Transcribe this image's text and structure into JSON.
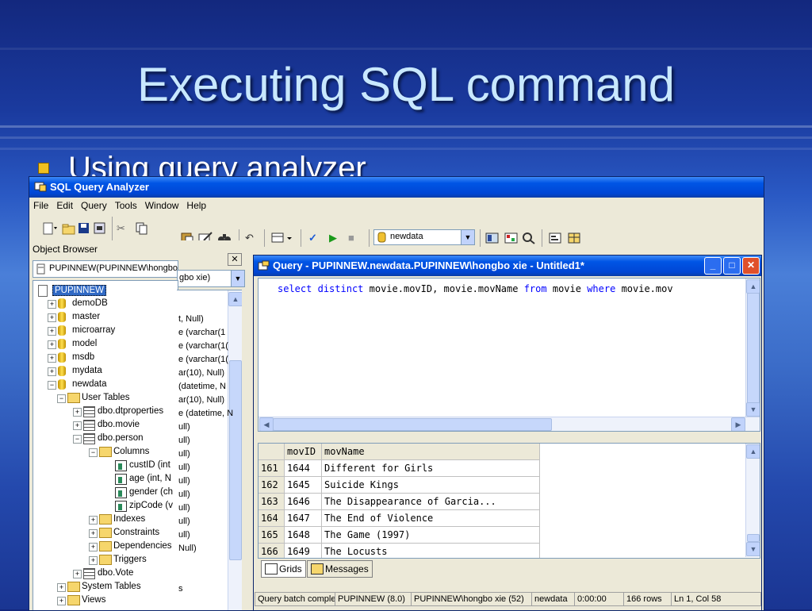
{
  "slide": {
    "title": "Executing SQL command",
    "bullet": "Using query analyzer"
  },
  "app": {
    "title": "SQL Query Analyzer",
    "menu": [
      "File",
      "Edit",
      "Query",
      "Tools",
      "Window",
      "Help"
    ],
    "toolbar": {
      "database": "newdata"
    }
  },
  "object_browser": {
    "label": "Object Browser",
    "server_select": "PUPINNEW(PUPINNEW\\hongbo xie)",
    "server_select_tail": "gbo xie)",
    "tree": [
      {
        "label": "PUPINNEW",
        "level": 0,
        "type": "server",
        "selected": true
      },
      {
        "label": "demoDB",
        "level": 1,
        "type": "db",
        "expander": "+"
      },
      {
        "label": "master",
        "level": 1,
        "type": "db",
        "expander": "+"
      },
      {
        "label": "microarray",
        "level": 1,
        "type": "db",
        "expander": "+"
      },
      {
        "label": "model",
        "level": 1,
        "type": "db",
        "expander": "+"
      },
      {
        "label": "msdb",
        "level": 1,
        "type": "db",
        "expander": "+"
      },
      {
        "label": "mydata",
        "level": 1,
        "type": "db",
        "expander": "+"
      },
      {
        "label": "newdata",
        "level": 1,
        "type": "db",
        "expander": "-"
      },
      {
        "label": "User Tables",
        "level": 2,
        "type": "folder",
        "expander": "-"
      },
      {
        "label": "dbo.dtproperties",
        "level": 3,
        "type": "table",
        "expander": "+"
      },
      {
        "label": "dbo.movie",
        "level": 3,
        "type": "table",
        "expander": "+"
      },
      {
        "label": "dbo.person",
        "level": 3,
        "type": "table",
        "expander": "-"
      },
      {
        "label": "Columns",
        "level": 4,
        "type": "folder",
        "expander": "-"
      },
      {
        "label": "custID (int",
        "level": 5,
        "type": "column"
      },
      {
        "label": "age (int, N",
        "level": 5,
        "type": "column"
      },
      {
        "label": "gender (ch",
        "level": 5,
        "type": "column"
      },
      {
        "label": "zipCode (v",
        "level": 5,
        "type": "column"
      },
      {
        "label": "Indexes",
        "level": 4,
        "type": "folder",
        "expander": "+"
      },
      {
        "label": "Constraints",
        "level": 4,
        "type": "folder",
        "expander": "+"
      },
      {
        "label": "Dependencies",
        "level": 4,
        "type": "folder",
        "expander": "+"
      },
      {
        "label": "Triggers",
        "level": 4,
        "type": "folder",
        "expander": "+"
      },
      {
        "label": "dbo.Vote",
        "level": 3,
        "type": "table",
        "expander": "+"
      },
      {
        "label": "System Tables",
        "level": 2,
        "type": "folder",
        "expander": "+"
      },
      {
        "label": "Views",
        "level": 2,
        "type": "folder",
        "expander": "+"
      }
    ],
    "right_fragments": [
      "t, Null)",
      "e (varchar(1",
      "e (varchar(1(",
      "e (varchar(1(",
      "ar(10), Null)",
      "(datetime, N",
      "ar(10), Null)",
      "e (datetime, N",
      "ull)",
      "ull)",
      "ull)",
      "ull)",
      "ull)",
      "ull)",
      "ull)",
      "ull)",
      "ull)",
      "Null)",
      "",
      "",
      "s"
    ]
  },
  "query_window": {
    "title": "Query - PUPINNEW.newdata.PUPINNEW\\hongbo xie - Untitled1*",
    "sql": {
      "kw_select": "select",
      "kw_distinct": "distinct",
      "part1": "movie.movID, movie.movName",
      "kw_from": "from",
      "part2": "movie",
      "kw_where": "where",
      "part3": "movie.mov"
    },
    "grid": {
      "columns": [
        "movID",
        "movName"
      ],
      "rows": [
        {
          "n": "161",
          "movID": "1644",
          "movName": "Different for Girls"
        },
        {
          "n": "162",
          "movID": "1645",
          "movName": "Suicide Kings"
        },
        {
          "n": "163",
          "movID": "1646",
          "movName": "The Disappearance of Garcia..."
        },
        {
          "n": "164",
          "movID": "1647",
          "movName": "The End of Violence"
        },
        {
          "n": "165",
          "movID": "1648",
          "movName": "The Game (1997)"
        },
        {
          "n": "166",
          "movID": "1649",
          "movName": "The Locusts"
        }
      ]
    },
    "tabs": [
      "Grids",
      "Messages"
    ],
    "status": [
      "Query batch comple",
      "PUPINNEW (8.0)",
      "PUPINNEW\\hongbo xie (52)",
      "newdata",
      "0:00:00",
      "166 rows",
      "Ln 1, Col 58"
    ]
  }
}
